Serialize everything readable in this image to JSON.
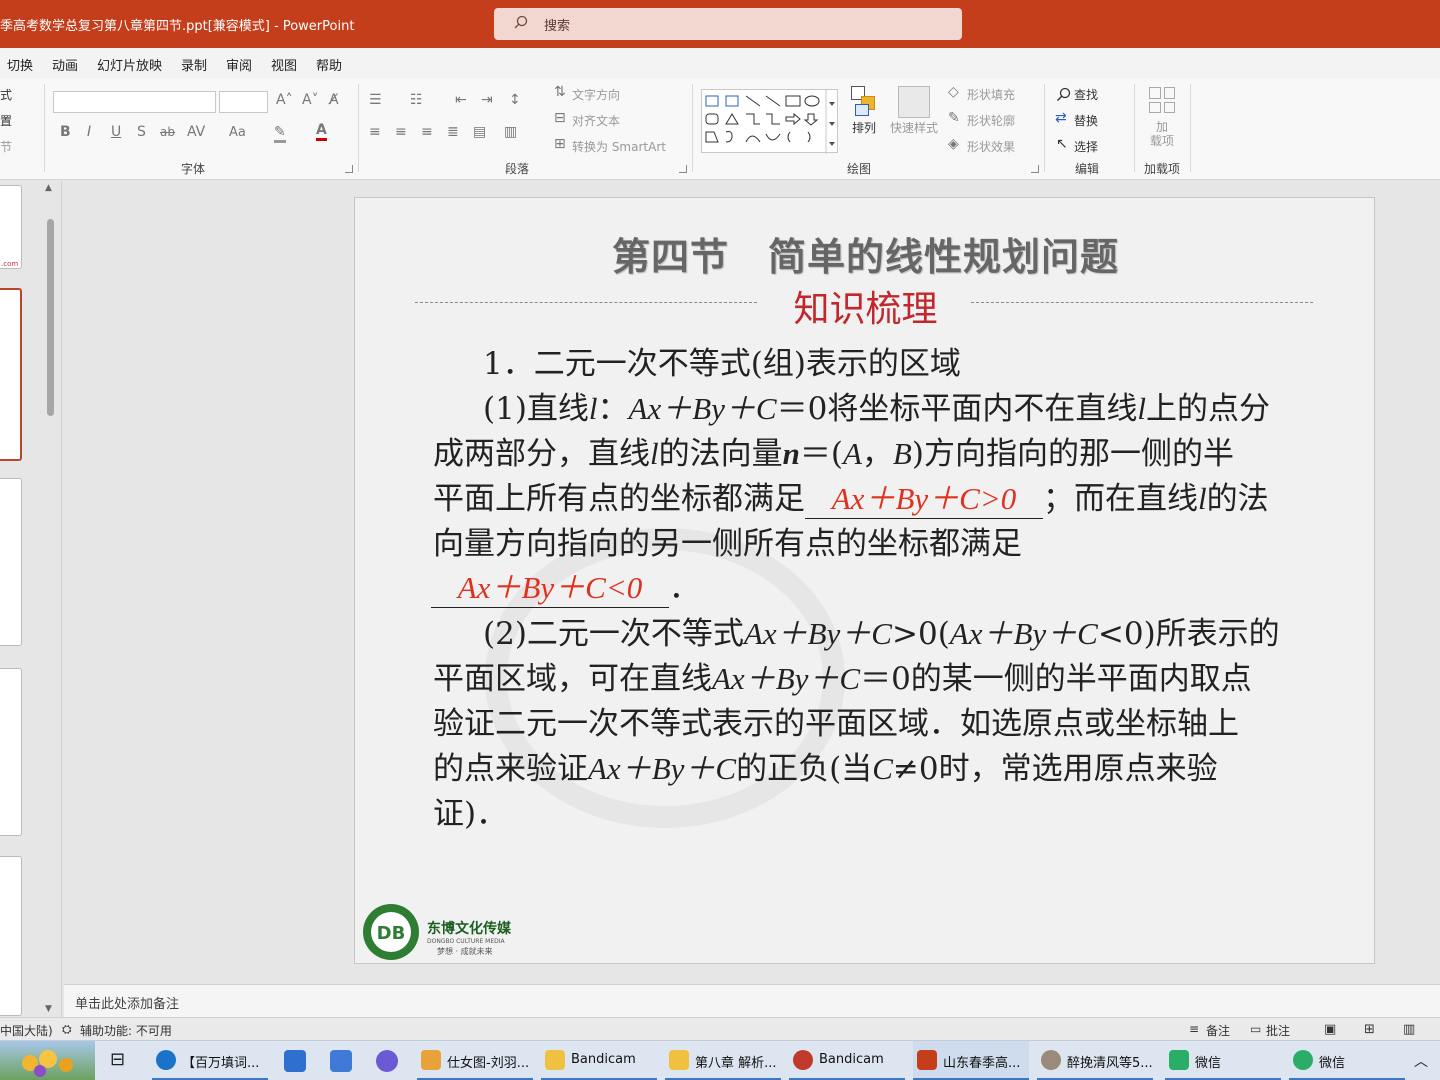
{
  "app": {
    "title": "季高考数学总复习第八章第四节.ppt[兼容模式]  -  PowerPoint",
    "search_placeholder": "搜索"
  },
  "menu": {
    "tabs": [
      "切换",
      "动画",
      "幻灯片放映",
      "录制",
      "审阅",
      "视图",
      "帮助"
    ]
  },
  "ribbon": {
    "groups": {
      "font": "字体",
      "paragraph": "段落",
      "drawing": "绘图",
      "editing": "编辑",
      "addins": "加载项"
    },
    "left_partial": [
      "式",
      "置",
      "节"
    ],
    "paragraph_cmds": {
      "text_direction": "文字方向",
      "align_text": "对齐文本",
      "smartart": "转换为 SmartArt"
    },
    "drawing_cmds": {
      "arrange": "排列",
      "quick_styles": "快速样式",
      "shape_fill": "形状填充",
      "shape_outline": "形状轮廓",
      "shape_effects": "形状效果"
    },
    "editing_cmds": {
      "find": "查找",
      "replace": "替换",
      "select": "选择"
    },
    "addins_cmd": "加\n载项",
    "font_buttons": [
      "B",
      "I",
      "U",
      "S",
      "ab",
      "AV",
      "Aa"
    ]
  },
  "slide": {
    "title": "第四节　简单的线性规划问题",
    "subtitle": "知识梳理",
    "heading1": "1．二元一次不等式(组)表示的区域",
    "p1_l1_a": "(1)直线",
    "p1_l1_b": "：",
    "p1_l1_c": "＝0将坐标平面内不在直线",
    "p1_l1_d": "上的点分",
    "p1_l2_a": "成两部分，直线",
    "p1_l2_b": "的法向量",
    "p1_l2_c": "＝(",
    "p1_l2_d": "，",
    "p1_l2_e": ")方向指向的那一侧的半",
    "p1_l3_a": "平面上所有点的坐标都满足",
    "p1_l3_b": "；而在直线",
    "p1_l3_c": "的法",
    "p1_l4": "向量方向指向的另一侧所有点的坐标都满足",
    "p1_l5_end": "．",
    "answer1": "Ax＋By＋C>0",
    "answer2": "Ax＋By＋C<0",
    "var_l": "l",
    "var_n": "n",
    "var_A": "A",
    "var_B": "B",
    "expr_line": "Ax＋By＋C",
    "p2_l1_a": "(2)二元一次不等式",
    "p2_l1_b": ">0(",
    "p2_l1_c": "<0)所表示的",
    "p2_l2_a": "平面区域，可在直线",
    "p2_l2_b": "＝0的某一侧的半平面内取点",
    "p2_l3": "验证二元一次不等式表示的平面区域．如选原点或坐标轴上",
    "p2_l4_a": "的点来验证",
    "p2_l4_b": "的正负(当",
    "p2_l4_c": "≠0时，常选用原点来验",
    "var_C": "C",
    "p2_l5": "证)．",
    "logo_text": "东博文化传媒",
    "logo_sub": "DONGBO CULTURE MEDIA",
    "logo_tag": "梦想 · 成就未来"
  },
  "thumbs": {
    "first_tail": ".com"
  },
  "notes": {
    "placeholder": "单击此处添加备注"
  },
  "status": {
    "language": "中国大陆)",
    "accessibility": "辅助功能: 不可用",
    "notes_btn": "备注",
    "comments_btn": "批注"
  },
  "taskbar": {
    "items": [
      {
        "label": "【百万填词...",
        "color": "#1a73c8"
      },
      {
        "label": "仕女图-刘羽...",
        "color": "#e8a23a"
      },
      {
        "label": "Bandicam",
        "color": "#f0c040"
      },
      {
        "label": "第八章 解析...",
        "color": "#f0c040"
      },
      {
        "label": "Bandicam",
        "color": "#c0392b"
      },
      {
        "label": "山东春季高...",
        "color": "#c43e1c"
      },
      {
        "label": "醉挽清风等5...",
        "color": "#9a8a7a"
      },
      {
        "label": "微信",
        "color": "#2aae67"
      },
      {
        "label": "微信",
        "color": "#2aae67"
      }
    ]
  },
  "colors": {
    "accent": "#c43e1c",
    "answer_red": "#e0301e",
    "subtitle_red": "#c1272d"
  }
}
